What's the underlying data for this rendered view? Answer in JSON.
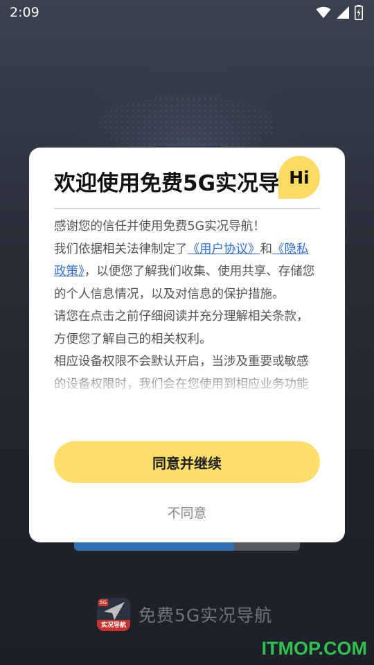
{
  "status_bar": {
    "time": "2:09",
    "icons": [
      "wifi-icon",
      "signal-icon",
      "battery-charging-icon"
    ]
  },
  "dialog": {
    "title": "欢迎使用免费5G实况导航",
    "badge": "Hi",
    "body": {
      "p1": "感谢您的信任并使用免费5G实况导航！",
      "p2_prefix": "我们依据相关法律制定了",
      "user_agreement_link": "《用户协议》",
      "p2_and": "和",
      "privacy_policy_link": "《隐私政策》",
      "p2_suffix": "，以便您了解我们收集、使用共享、存储您的个人信息情况，以及对信息的保护措施。",
      "p3": "请您在点击之前仔细阅读并充分理解相关条款，方便您了解自己的相关权利。",
      "p4": "相应设备权限不会默认开启，当涉及重要或敏感的设备权限时，我们会在您使用到相应业务功能"
    },
    "agree_label": "同意并继续",
    "disagree_label": "不同意"
  },
  "loading": {
    "progress": 0.71
  },
  "brand": {
    "app_name": "免费5G实况导航",
    "logo_band_text": "实况导航",
    "logo_badge_text": "5G"
  },
  "watermark": "ITMOP.COM",
  "colors": {
    "accent_yellow": "#fbdf6a",
    "link_blue": "#2f6fd6",
    "watermark_green": "#2fc24e"
  }
}
